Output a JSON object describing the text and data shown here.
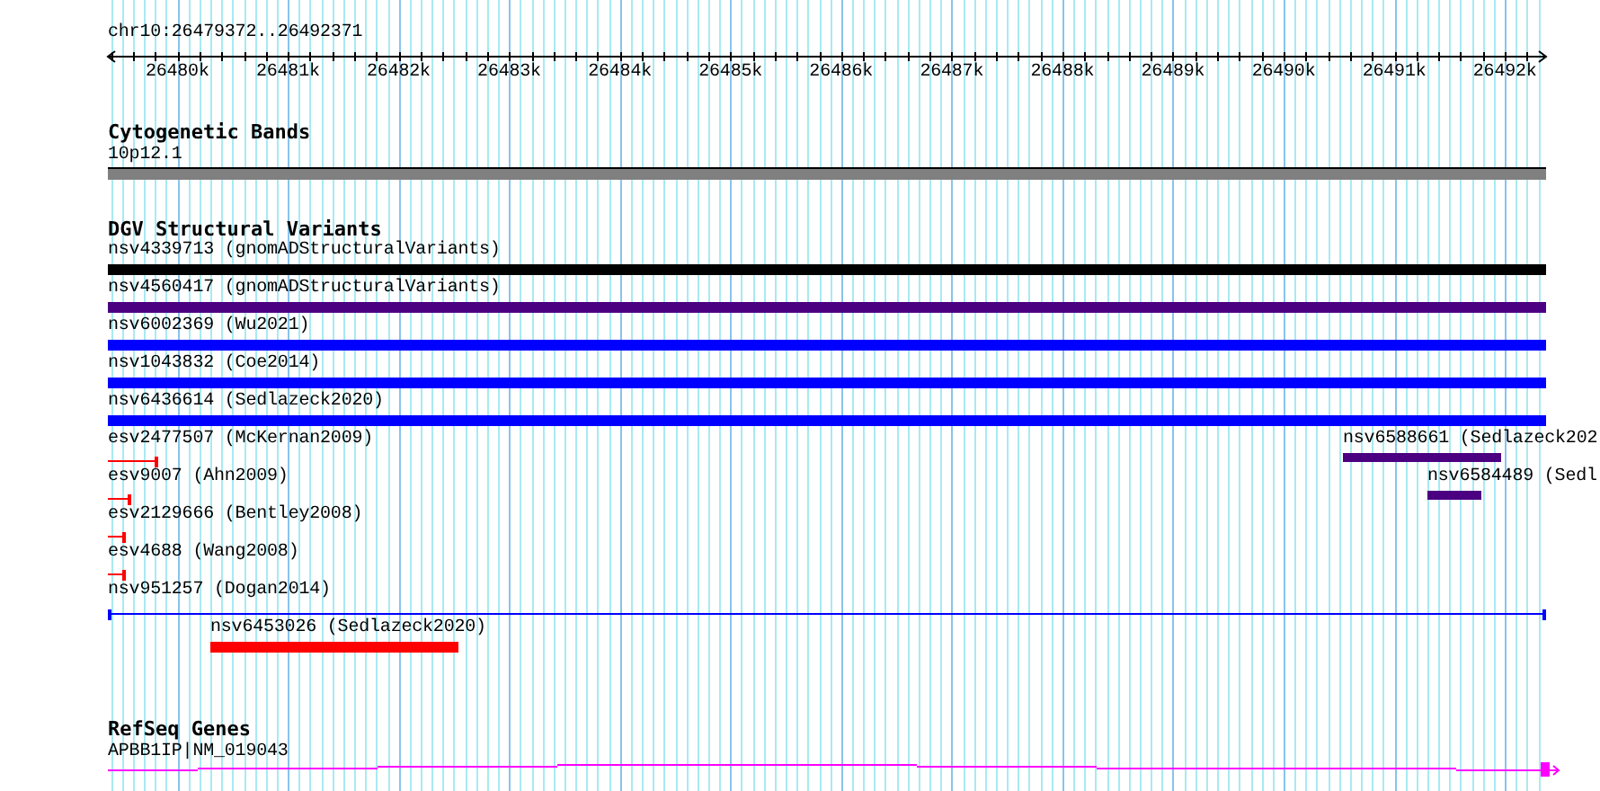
{
  "ruler": {
    "location": "chr10:26479372..26492371",
    "ticks": [
      "26480k",
      "26481k",
      "26482k",
      "26483k",
      "26484k",
      "26485k",
      "26486k",
      "26487k",
      "26488k",
      "26489k",
      "26490k",
      "26491k",
      "26492k"
    ]
  },
  "tracks": [
    {
      "title": "Cytogenetic Bands",
      "features": [
        {
          "kind": "band",
          "label": "10p12.1",
          "color": "#808080"
        }
      ]
    },
    {
      "title": "DGV Structural Variants",
      "features": [
        {
          "kind": "bar",
          "label": "nsv4339713 (gnomADStructuralVariants)",
          "color": "#000000"
        },
        {
          "kind": "bar",
          "label": "nsv4560417 (gnomADStructuralVariants)",
          "color": "#4b0082"
        },
        {
          "kind": "bar",
          "label": "nsv6002369 (Wu2021)",
          "color": "#0000ff"
        },
        {
          "kind": "bar",
          "label": "nsv1043832 (Coe2014)",
          "color": "#0000ff"
        },
        {
          "kind": "bar",
          "label": "nsv6436614 (Sedlazeck2020)",
          "color": "#0000ff"
        },
        {
          "kind": "line",
          "label": "esv2477507 (McKernan2009)",
          "color": "#ff0000"
        },
        {
          "kind": "bar",
          "label": "nsv6588661 (Sedlazeck202",
          "color": "#4b0082"
        },
        {
          "kind": "line",
          "label": "esv9007 (Ahn2009)",
          "color": "#ff0000"
        },
        {
          "kind": "bar",
          "label": "nsv6584489 (Sedl",
          "color": "#4b0082"
        },
        {
          "kind": "line",
          "label": "esv2129666 (Bentley2008)",
          "color": "#ff0000"
        },
        {
          "kind": "line",
          "label": "esv4688 (Wang2008)",
          "color": "#ff0000"
        },
        {
          "kind": "line",
          "label": "nsv951257 (Dogan2014)",
          "color": "#0000ff"
        },
        {
          "kind": "bar",
          "label": "nsv6453026 (Sedlazeck2020)",
          "color": "#ff0000"
        }
      ]
    },
    {
      "title": "RefSeq Genes",
      "features": [
        {
          "kind": "gene",
          "label": "APBB1IP|NM_019043",
          "color": "#ff00ff"
        }
      ]
    }
  ]
}
